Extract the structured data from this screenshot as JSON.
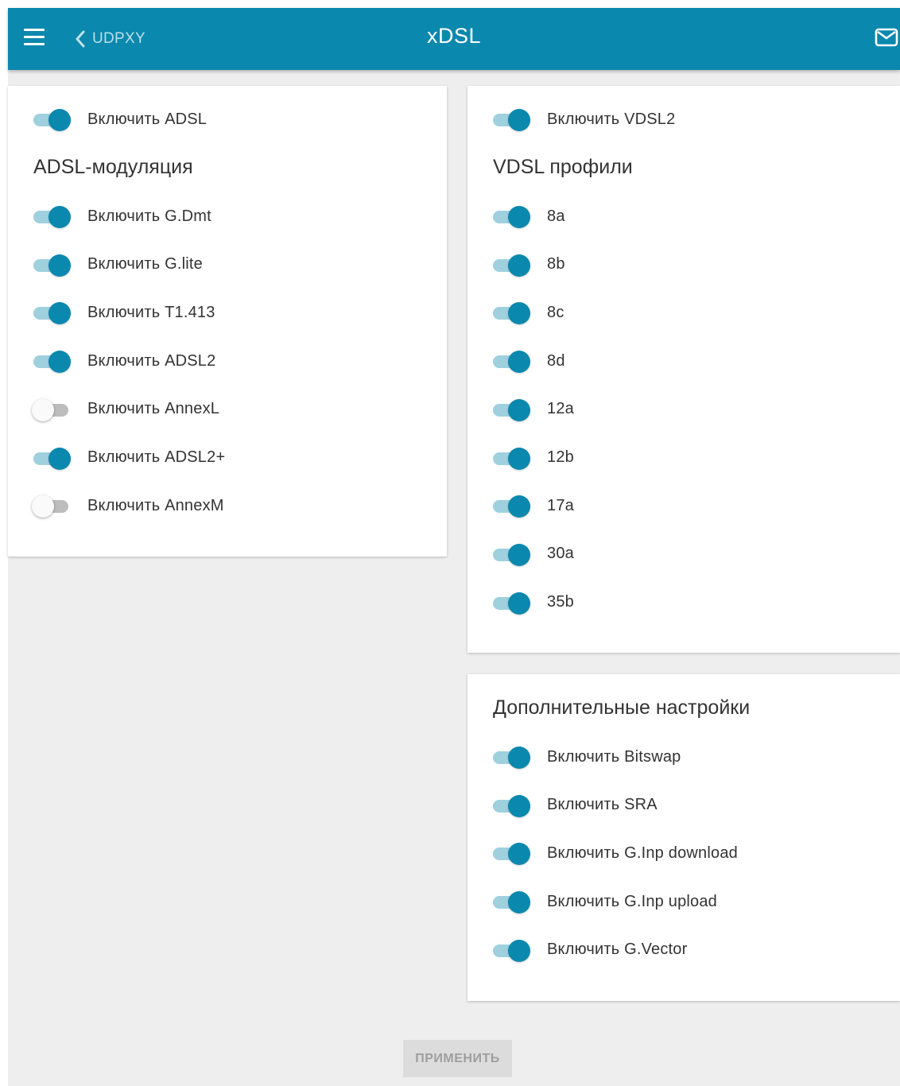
{
  "header": {
    "back_label": "UDPXY",
    "title": "xDSL"
  },
  "adsl": {
    "enable_label": "Включить ADSL",
    "enable_on": true,
    "section_title": "ADSL-модуляция",
    "modulations": [
      {
        "label": "Включить G.Dmt",
        "on": true
      },
      {
        "label": "Включить G.lite",
        "on": true
      },
      {
        "label": "Включить T1.413",
        "on": true
      },
      {
        "label": "Включить ADSL2",
        "on": true
      },
      {
        "label": "Включить AnnexL",
        "on": false
      },
      {
        "label": "Включить ADSL2+",
        "on": true
      },
      {
        "label": "Включить AnnexM",
        "on": false
      }
    ]
  },
  "vdsl": {
    "enable_label": "Включить VDSL2",
    "enable_on": true,
    "section_title": "VDSL профили",
    "profiles": [
      {
        "label": "8a",
        "on": true
      },
      {
        "label": "8b",
        "on": true
      },
      {
        "label": "8c",
        "on": true
      },
      {
        "label": "8d",
        "on": true
      },
      {
        "label": "12a",
        "on": true
      },
      {
        "label": "12b",
        "on": true
      },
      {
        "label": "17a",
        "on": true
      },
      {
        "label": "30a",
        "on": true
      },
      {
        "label": "35b",
        "on": true
      }
    ]
  },
  "advanced": {
    "section_title": "Дополнительные настройки",
    "options": [
      {
        "label": "Включить Bitswap",
        "on": true
      },
      {
        "label": "Включить SRA",
        "on": true
      },
      {
        "label": "Включить G.Inp download",
        "on": true
      },
      {
        "label": "Включить G.Inp upload",
        "on": true
      },
      {
        "label": "Включить G.Vector",
        "on": true
      }
    ]
  },
  "apply_label": "ПРИМЕНИТЬ",
  "colors": {
    "accent": "#0a88ae",
    "switch_track_on": "#9fd0dd",
    "switch_track_off": "#bdbdbd",
    "background": "#eeeeee"
  },
  "icons": {
    "menu": "hamburger-icon",
    "back": "chevron-left-icon",
    "mail": "mail-icon"
  }
}
